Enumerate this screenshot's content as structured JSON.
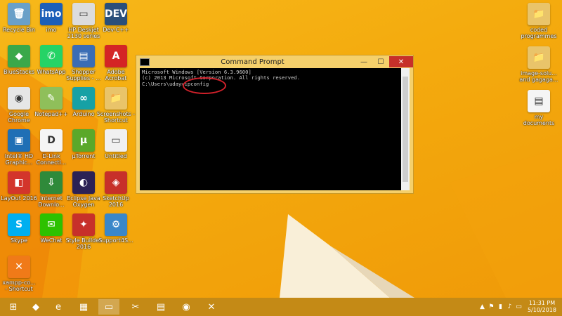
{
  "desktop": {
    "left_icons": [
      {
        "name": "recycle-bin",
        "label": "Recycle Bin",
        "glyph": "🗑",
        "color": "#6aa0c8"
      },
      {
        "name": "imo",
        "label": "imo",
        "glyph": "imo",
        "color": "#1c5fb8"
      },
      {
        "name": "hp-deskjet",
        "label": "HP Deskjet\n2130 series",
        "glyph": "▭",
        "color": "#dcdcdc"
      },
      {
        "name": "dev-cpp",
        "label": "Dev-C++",
        "glyph": "DEV",
        "color": "#2b4f7a"
      },
      {
        "name": "bluestacks",
        "label": "BlueStacks",
        "glyph": "◆",
        "color": "#3aa84a"
      },
      {
        "name": "whatsapp",
        "label": "WhatsApp",
        "glyph": "✆",
        "color": "#25d366"
      },
      {
        "name": "shopper-supplies",
        "label": "Shopper\nSupplies - ...",
        "glyph": "▤",
        "color": "#3b6db5"
      },
      {
        "name": "adobe-acrobat",
        "label": "Adobe\nAcrobat",
        "glyph": "A",
        "color": "#d42525"
      },
      {
        "name": "google-chrome",
        "label": "Google\nChrome",
        "glyph": "◉",
        "color": "#e6e6e6"
      },
      {
        "name": "notepad-plus-plus",
        "label": "Notepad++",
        "glyph": "✎",
        "color": "#8fbf5a"
      },
      {
        "name": "arduino",
        "label": "Arduino",
        "glyph": "∞",
        "color": "#17a1a5"
      },
      {
        "name": "screenshots-shortcut",
        "label": "Screenshots -\nShortcut",
        "glyph": "📁",
        "color": "#e9c46a"
      },
      {
        "name": "intel-hd-graphics",
        "label": "Intel® HD\nGraphic...",
        "glyph": "▣",
        "color": "#1f6fb5"
      },
      {
        "name": "dlink-connect",
        "label": "D-Link\nConnecti...",
        "glyph": "D",
        "color": "#f5f5f5"
      },
      {
        "name": "utorrent",
        "label": "µTorrent",
        "glyph": "µ",
        "color": "#5aa82a"
      },
      {
        "name": "untitled",
        "label": "Untitled",
        "glyph": "▭",
        "color": "#f0f0f0"
      },
      {
        "name": "layout-2016",
        "label": "LayOut 2016",
        "glyph": "◧",
        "color": "#d3352b"
      },
      {
        "name": "internet-download",
        "label": "Internet\nDownlo...",
        "glyph": "⇩",
        "color": "#2f8a3a"
      },
      {
        "name": "eclipse-java",
        "label": "Eclipse Java\nOxygen",
        "glyph": "◐",
        "color": "#2c2255"
      },
      {
        "name": "sketchup-2016",
        "label": "SketchUp\n2016",
        "glyph": "◈",
        "color": "#c7302a"
      },
      {
        "name": "skype",
        "label": "Skype",
        "glyph": "S",
        "color": "#00aff0"
      },
      {
        "name": "wechat",
        "label": "WeChat",
        "glyph": "✉",
        "color": "#2dc100"
      },
      {
        "name": "style-builder",
        "label": "Style Builder\n2016",
        "glyph": "✦",
        "color": "#c7302a"
      },
      {
        "name": "support4s",
        "label": "Support4S...",
        "glyph": "⚙",
        "color": "#3a87c9"
      },
      {
        "name": "xampp-control",
        "label": "xampp-co...\n- Shortcut",
        "glyph": "✕",
        "color": "#f07a18"
      }
    ],
    "right_icons": [
      {
        "name": "coded-programmes",
        "label": "coded\nprogrammes",
        "glyph": "📁",
        "color": "#e9c46a"
      },
      {
        "name": "image-folder",
        "label": "image-solu...\nand gagaga...",
        "glyph": "📁",
        "color": "#e9c46a"
      },
      {
        "name": "my-documents",
        "label": "my\ndocuments",
        "glyph": "▤",
        "color": "#f5f5f5"
      }
    ]
  },
  "cmd": {
    "title": "Command Prompt",
    "minimize": "—",
    "maximize": "☐",
    "close": "✕",
    "console_lines": [
      "Microsoft Windows [Version 6.3.9600]",
      "(c) 2013 Microsoft Corporation. All rights reserved.",
      "",
      "C:\\Users\\uday>ipconfig"
    ]
  },
  "taskbar": {
    "items": [
      {
        "name": "start-button",
        "glyph": "⊞"
      },
      {
        "name": "bluestacks-taskbar",
        "glyph": "◆"
      },
      {
        "name": "internet-explorer-taskbar",
        "glyph": "e"
      },
      {
        "name": "store-taskbar",
        "glyph": "▦"
      },
      {
        "name": "command-prompt-taskbar",
        "glyph": "▭"
      },
      {
        "name": "snipping-tool-taskbar",
        "glyph": "✂"
      },
      {
        "name": "file-explorer-taskbar",
        "glyph": "▤"
      },
      {
        "name": "chrome-taskbar",
        "glyph": "◉"
      },
      {
        "name": "xampp-taskbar",
        "glyph": "✕"
      }
    ],
    "time": "11:31 PM",
    "date": "5/10/2018"
  }
}
